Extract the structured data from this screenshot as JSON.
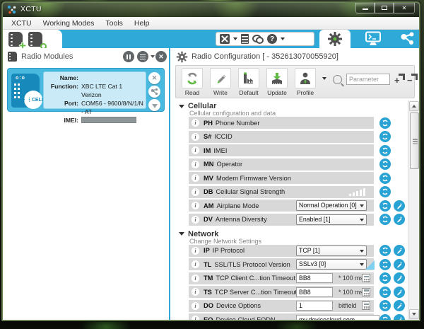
{
  "titlebar": {
    "title": "XCTU",
    "close_glyph": "✕"
  },
  "menubar": {
    "items": [
      "XCTU",
      "Working Modes",
      "Tools",
      "Help"
    ]
  },
  "modules_panel": {
    "title": "Radio Modules",
    "card": {
      "name_label": "Name:",
      "name_value": "",
      "function_label": "Function:",
      "function_value": "XBC LTE Cat 1 Verizon",
      "port_label": "Port:",
      "port_value": "COM56 - 9600/8/N/1/N - AT",
      "imei_label": "IMEI:",
      "imei_value": ""
    },
    "card_close_glyph": "✕"
  },
  "config_panel": {
    "title": "Radio Configuration [ - 352613070055920]",
    "toolbar": {
      "read": "Read",
      "write": "Write",
      "default": "Default",
      "update": "Update",
      "profile": "Profile",
      "search_placeholder": "Parameter"
    },
    "sections": [
      {
        "title": "Cellular",
        "description": "Cellular configuration and data",
        "rows": [
          {
            "code": "PH",
            "label": "Phone Number",
            "control": "none",
            "actions": [
              "refresh"
            ]
          },
          {
            "code": "S#",
            "label": "ICCID",
            "control": "none",
            "actions": [
              "refresh"
            ]
          },
          {
            "code": "IM",
            "label": "IMEI",
            "control": "none",
            "actions": [
              "refresh"
            ]
          },
          {
            "code": "MN",
            "label": "Operator",
            "control": "none",
            "actions": [
              "refresh"
            ]
          },
          {
            "code": "MV",
            "label": "Modem Firmware Version",
            "control": "none",
            "actions": [
              "refresh"
            ]
          },
          {
            "code": "DB",
            "label": "Cellular Signal Strength",
            "control": "signal",
            "actions": [
              "refresh"
            ]
          },
          {
            "code": "AM",
            "label": "Airplane Mode",
            "control": "select",
            "value": "Normal Operation [0]",
            "actions": [
              "refresh",
              "write"
            ]
          },
          {
            "code": "DV",
            "label": "Antenna Diversity",
            "control": "select",
            "value": "Enabled [1]",
            "actions": [
              "refresh",
              "write"
            ]
          }
        ]
      },
      {
        "title": "Network",
        "description": "Change Network Settings",
        "rows": [
          {
            "code": "IP",
            "label": "IP Protocol",
            "control": "select",
            "value": "TCP [1]",
            "actions": [
              "refresh",
              "write"
            ]
          },
          {
            "code": "TL",
            "label": "SSL/TLS Protocol Version",
            "control": "select",
            "value": "SSLv3 [0]",
            "selected": true,
            "actions": [
              "refresh",
              "write"
            ]
          },
          {
            "code": "TM",
            "label": "TCP Client C...tion Timeout",
            "control": "input",
            "value": "BB8",
            "unit": "* 100 ms",
            "calculator": true,
            "actions": [
              "refresh",
              "write"
            ]
          },
          {
            "code": "TS",
            "label": "TCP Server C...tion Timeout",
            "control": "input",
            "value": "BB8",
            "unit": "* 100 ms",
            "calculator": true,
            "actions": [
              "refresh",
              "write"
            ]
          },
          {
            "code": "DO",
            "label": "Device Options",
            "control": "input",
            "value": "1",
            "unit": "bitfield",
            "calculator": true,
            "actions": [
              "refresh",
              "write"
            ]
          },
          {
            "code": "EQ",
            "label": "Device Cloud FQDN",
            "control": "input-wide",
            "value": "my.devicecloud.com",
            "actions": [
              "refresh",
              "write"
            ]
          }
        ]
      }
    ],
    "signal_bars": [
      3,
      5,
      7,
      9,
      11
    ]
  },
  "colors": {
    "accent_blue": "#2fa9d8",
    "action_blue": "#29a3d4",
    "card_blue": "#4ab9e0",
    "card_inner_blue": "#c9eaf6",
    "row_gray": "#d8d8d8",
    "green": "#62b944"
  }
}
